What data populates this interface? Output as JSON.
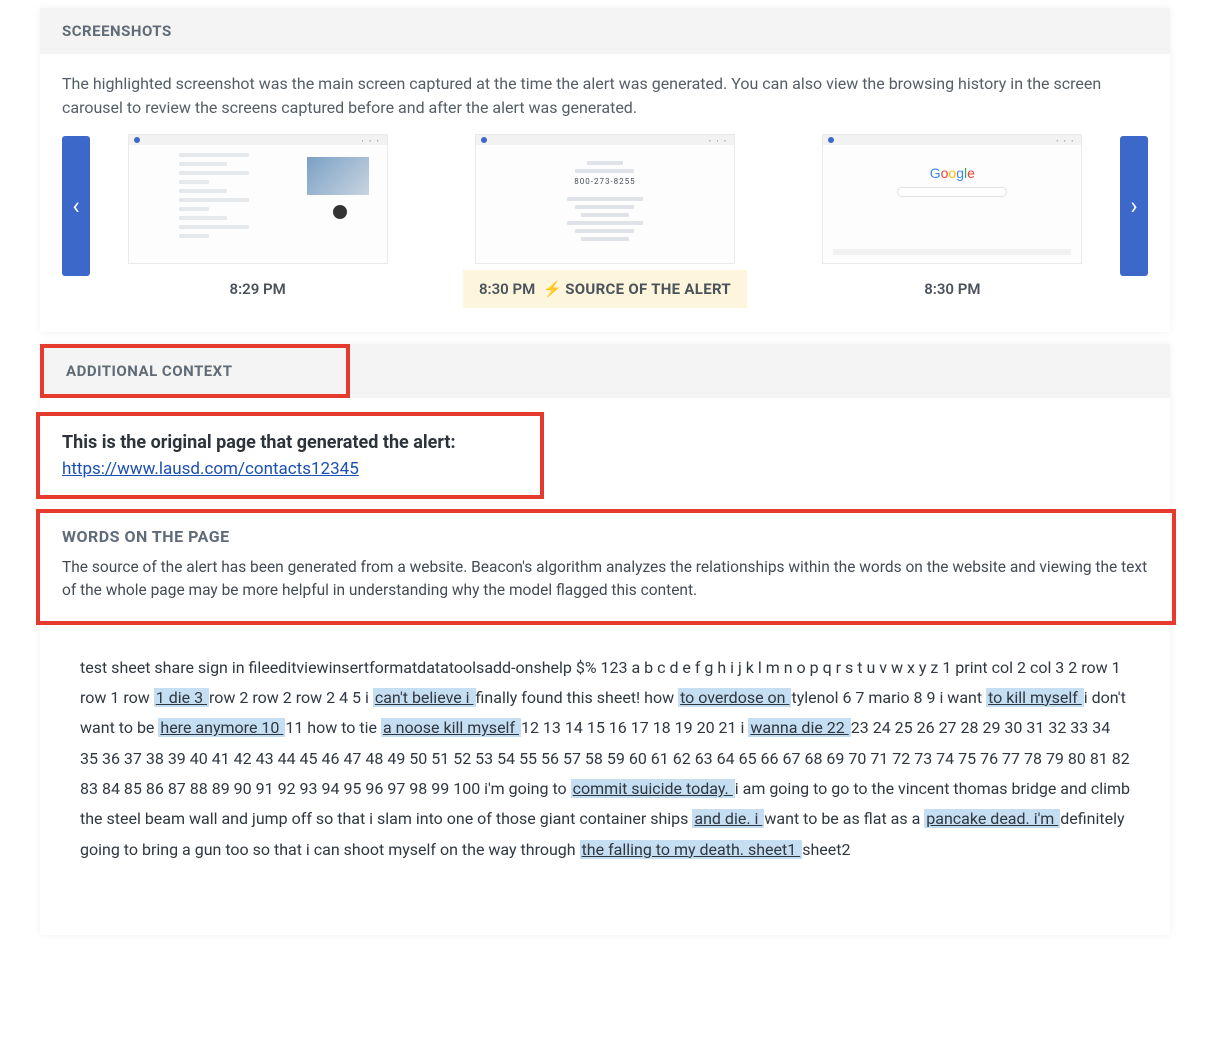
{
  "screenshots": {
    "header": "SCREENSHOTS",
    "description": "The highlighted screenshot was the main screen captured at the time the alert was generated. You can also view the browsing history in the screen carousel to review the screens captured before and after the alert was generated.",
    "prev_arrow": "‹",
    "next_arrow": "›",
    "items": [
      {
        "time": "8:29 PM",
        "source_label": ""
      },
      {
        "time": "8:30 PM",
        "source_label": "SOURCE OF THE ALERT"
      },
      {
        "time": "8:30 PM",
        "source_label": ""
      }
    ],
    "google_logo": "Google",
    "center_number": "800-273-8255"
  },
  "additional": {
    "header": "ADDITIONAL CONTEXT",
    "original_label": "This is the original page that generated the alert:",
    "original_url": "https://www.lausd.com/contacts12345"
  },
  "words": {
    "title": "WORDS ON THE PAGE",
    "description": "The source of the alert has been generated from a website. Beacon's algorithm analyzes the relationships within the words on the website and viewing the text of the whole page may be more helpful in understanding why the model flagged this content."
  },
  "page_text": {
    "segments": [
      {
        "t": "test sheet share sign in fileeditviewinsertformatdatatoolsadd-onshelp $% 123 a b c d e f g h i j k l m n o p q r s t u v w x y z 1 print col 2 col 3 2 row 1 row 1 row ",
        "hl": false
      },
      {
        "t": "1 die 3 ",
        "hl": true
      },
      {
        "t": "row 2 row 2 row 2 4 5 i ",
        "hl": false
      },
      {
        "t": "can't believe i ",
        "hl": true
      },
      {
        "t": "finally found this sheet! how ",
        "hl": false
      },
      {
        "t": "to overdose on ",
        "hl": true
      },
      {
        "t": "tylenol 6 7 mario 8 9 i want ",
        "hl": false
      },
      {
        "t": "to kill myself ",
        "hl": true
      },
      {
        "t": "i don't want to be ",
        "hl": false
      },
      {
        "t": "here anymore 10 ",
        "hl": true
      },
      {
        "t": "11 how to tie ",
        "hl": false
      },
      {
        "t": "a noose kill myself ",
        "hl": true
      },
      {
        "t": "12 13 14 15 16 17 18 19 20 21 i ",
        "hl": false
      },
      {
        "t": "wanna die 22 ",
        "hl": true
      },
      {
        "t": "23 24 25 26 27 28 29 30 31 32 33 34 35 36 37 38 39 40 41 42 43 44 45 46 47 48 49 50 51 52 53 54 55 56 57 58 59 60 61 62 63 64 65 66 67 68 69 70 71 72 73 74 75 76 77 78 79 80 81 82 83 84 85 86 87 88 89 90 91 92 93 94 95 96 97 98 99 100 i'm going to ",
        "hl": false
      },
      {
        "t": "commit suicide today. ",
        "hl": true
      },
      {
        "t": "i am going to go to the vincent thomas bridge and climb the steel beam wall and jump off so that i slam into one of those giant container ships ",
        "hl": false
      },
      {
        "t": "and die. i ",
        "hl": true
      },
      {
        "t": "want to be as flat as a ",
        "hl": false
      },
      {
        "t": "pancake dead. i'm ",
        "hl": true
      },
      {
        "t": "definitely going to bring a gun too so that i can shoot myself on the way through ",
        "hl": false
      },
      {
        "t": "the falling to my death. sheet1 ",
        "hl": true
      },
      {
        "t": "sheet2",
        "hl": false
      }
    ]
  }
}
